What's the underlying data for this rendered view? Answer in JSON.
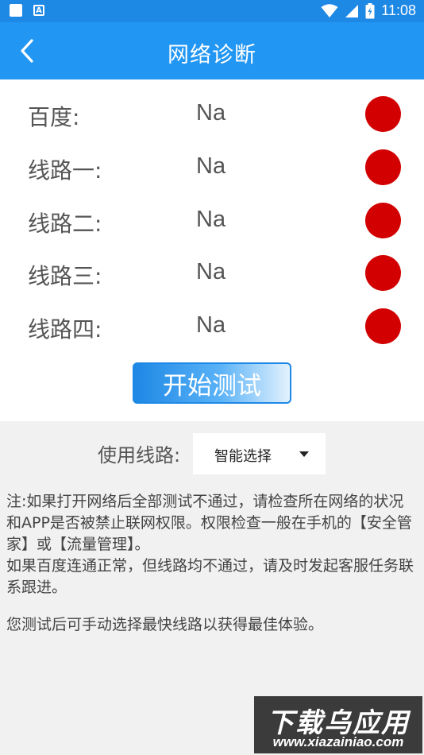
{
  "status_bar": {
    "time": "11:08",
    "icons": [
      "notification-square-icon",
      "a-letter-icon",
      "wifi-icon",
      "cell-signal-icon",
      "battery-charging-icon"
    ],
    "a_glyph": "A"
  },
  "header": {
    "title": "网络诊断",
    "back_icon": "chevron-left-icon"
  },
  "diagnostics": [
    {
      "label": "百度:",
      "value": "Na",
      "status_color": "#d20000"
    },
    {
      "label": "线路一:",
      "value": "Na",
      "status_color": "#d20000"
    },
    {
      "label": "线路二:",
      "value": "Na",
      "status_color": "#d20000"
    },
    {
      "label": "线路三:",
      "value": "Na",
      "status_color": "#d20000"
    },
    {
      "label": "线路四:",
      "value": "Na",
      "status_color": "#d20000"
    }
  ],
  "start_button": {
    "label": "开始测试"
  },
  "route": {
    "label": "使用线路:",
    "selected": "智能选择"
  },
  "notes": {
    "line1": "注:如果打开网络后全部测试不通过，请检查所在网络的状况和APP是否被禁止联网权限。权限检查一般在手机的【安全管家】或【流量管理】。",
    "line2": "如果百度连通正常，但线路均不通过，请及时发起客服任务联系跟进。",
    "line3": "您测试后可手动选择最快线路以获得最佳体验。"
  },
  "watermark": {
    "title": "下载乌应用",
    "url": "www.xiazainiao.com"
  },
  "colors": {
    "status_bar": "#1e88e5",
    "app_bar": "#2196f3",
    "status_dot": "#d20000",
    "background": "#f1f1f1"
  }
}
